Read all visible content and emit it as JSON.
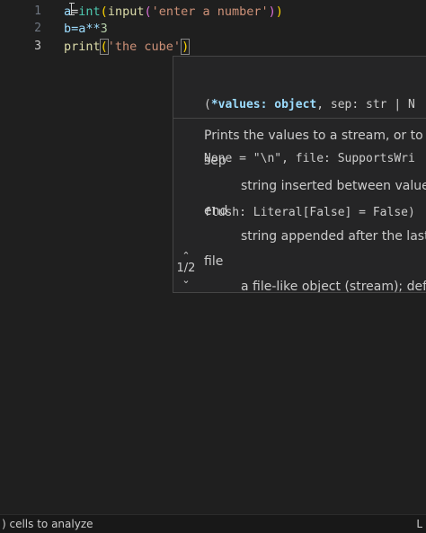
{
  "editor": {
    "line_numbers": [
      "1",
      "2",
      "3"
    ],
    "lines": [
      {
        "a": "a",
        "eq": "=",
        "int": "int",
        "p1": "(",
        "input": "input",
        "p2": "(",
        "s": "'enter a number'",
        "p3": ")",
        "p4": ")"
      },
      {
        "text": "b=a**",
        "num": "3"
      },
      {
        "print": "print",
        "p1": "(",
        "s": "'the cube'",
        "p2": ")"
      }
    ]
  },
  "hover": {
    "signature": [
      {
        "a": "(",
        "b": "*values: object",
        "c": ", sep: str | N"
      },
      {
        "a": "None = \"\\n\", file: SupportsWri"
      },
      {
        "a": "flush: Literal[False] = False)"
      }
    ],
    "description": "Prints the values to a stream, or to sys",
    "params": [
      {
        "name": "sep",
        "desc": "string inserted between values,"
      },
      {
        "name": "end",
        "desc": "string appended after the last v"
      },
      {
        "name": "file",
        "desc": "a file-like object (stream); defau"
      }
    ],
    "pager": "1/2"
  },
  "status": {
    "left": ") cells to analyze",
    "right": "L"
  }
}
